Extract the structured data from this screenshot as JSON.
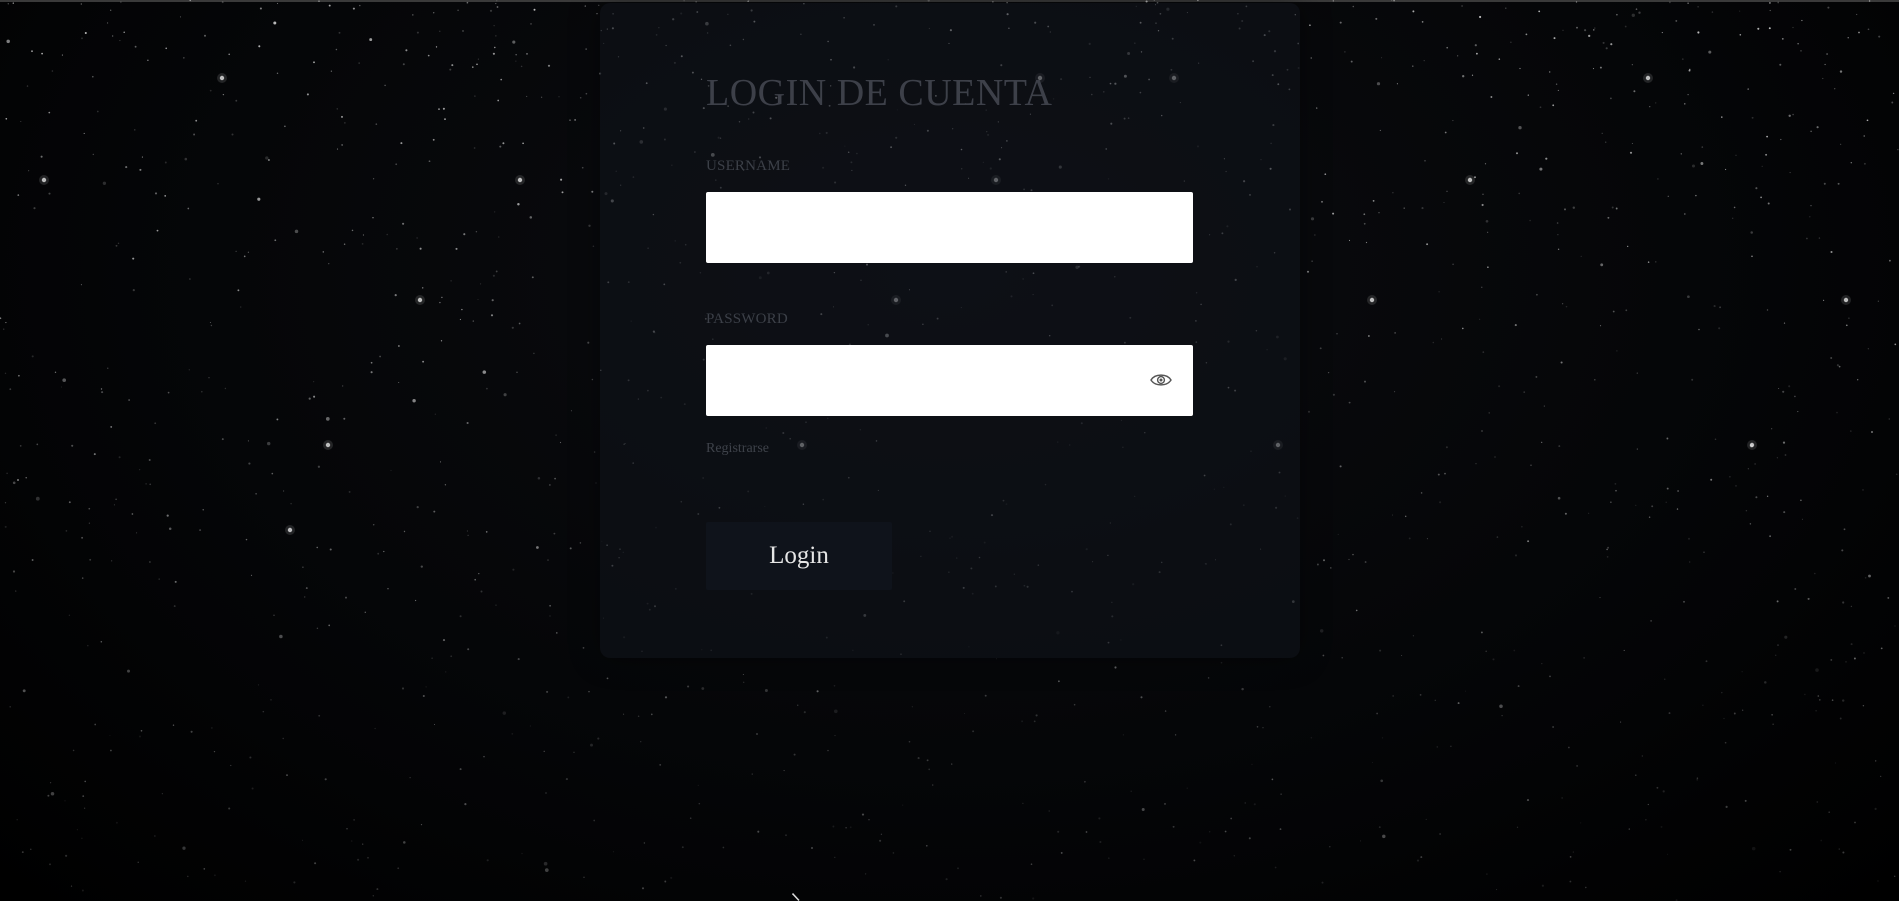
{
  "login": {
    "title": "LOGIN DE CUENTA",
    "username_label": "USERNAME",
    "username_value": "",
    "password_label": "PASSWORD",
    "password_value": "",
    "register_link": "Registrarse",
    "login_button": "Login"
  },
  "icons": {
    "password_toggle": "eye-icon"
  },
  "colors": {
    "background": "#000000",
    "card": "#10141c",
    "title": "#3d4049",
    "input_bg": "#ffffff",
    "button_bg": "#0f131b",
    "button_text": "#e6e6e6"
  }
}
